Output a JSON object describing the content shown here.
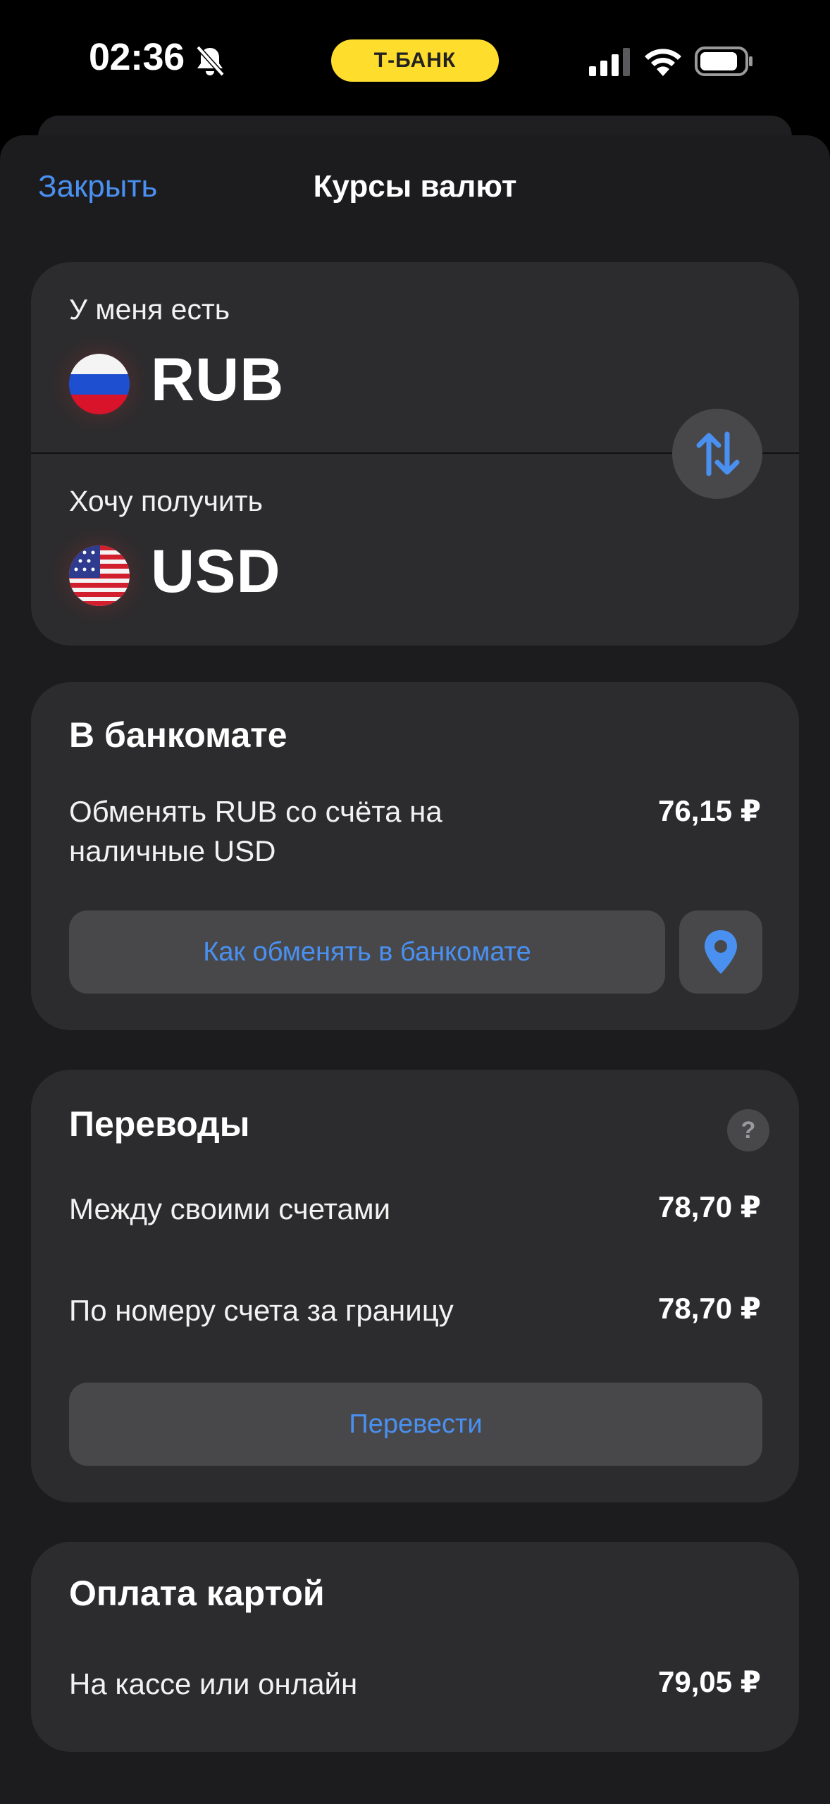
{
  "status_bar": {
    "time": "02:36",
    "island_brand": "Т-БАНК",
    "brand_color": "#FFDD2D"
  },
  "nav": {
    "close_label": "Закрыть",
    "title": "Курсы валют"
  },
  "currency": {
    "from_label": "У меня есть",
    "from_code": "RUB",
    "to_label": "Хочу получить",
    "to_code": "USD",
    "swap_icon": "swap-arrows-icon"
  },
  "atm": {
    "title": "В банкомате",
    "row_label": "Обменять RUB со счёта на наличные USD",
    "row_value": "76,15 ₽",
    "button_label": "Как обменять в банкомате",
    "map_icon": "map-pin-icon"
  },
  "transfers": {
    "title": "Переводы",
    "help_label": "?",
    "rows": [
      {
        "label": "Между своими счетами",
        "value": "78,70 ₽"
      },
      {
        "label": "По номеру счета за границу",
        "value": "78,70 ₽"
      }
    ],
    "button_label": "Перевести"
  },
  "card_payment": {
    "title": "Оплата картой",
    "rows": [
      {
        "label": "На кассе или онлайн",
        "value": "79,05 ₽"
      }
    ]
  },
  "colors": {
    "accent": "#4A90F0",
    "card_bg": "#2C2C2E",
    "sheet_bg": "#1C1C1E"
  }
}
